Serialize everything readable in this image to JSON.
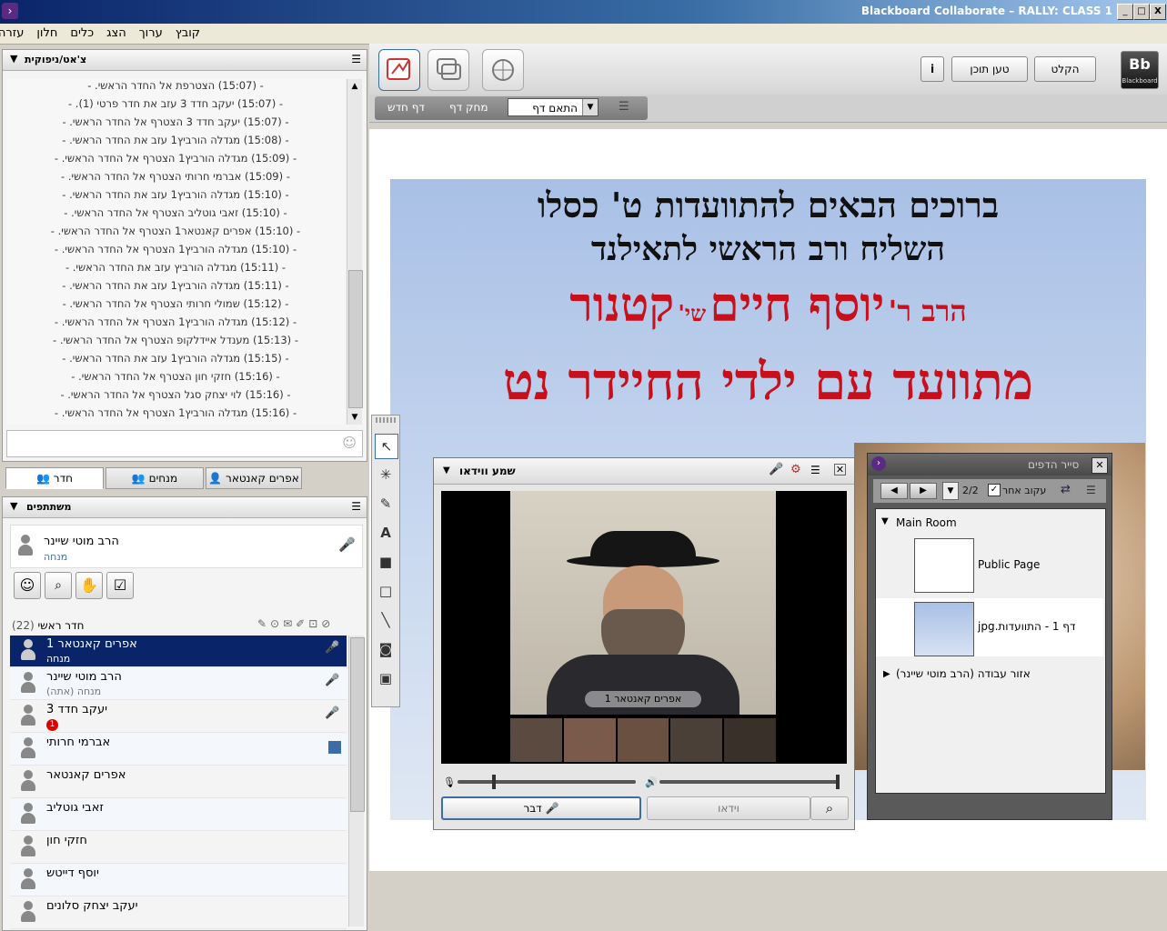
{
  "window": {
    "title": "Blackboard Collaborate – RALLY: CLASS 1",
    "minimize": "_",
    "maximize": "□",
    "close": "X"
  },
  "menu": [
    "עזרה",
    "חלון",
    "כלים",
    "הצג",
    "ערוך",
    "קובץ"
  ],
  "chat": {
    "title": "צ'אט/ניפוקית",
    "lines": [
      "- (15:07) הצטרפת אל החדר הראשי. -",
      "- (15:07) יעקב חדד 3 עזב את חדר פרטי (1). -",
      "- (15:07) יעקב חדד 3 הצטרף אל החדר הראשי. -",
      "- (15:08) מגדלה הורביץ1 עזב את החדר הראשי. -",
      "- (15:09) מגדלה הורביץ1 הצטרף אל החדר הראשי. -",
      "- (15:09) אברמי חרותי הצטרף אל החדר הראשי. -",
      "- (15:10) מגדלה הורביץ1 עזב את החדר הראשי. -",
      "- (15:10) זאבי גוטליב הצטרף אל החדר הראשי. -",
      "- (15:10) אפרים קאנטאר1 הצטרף אל החדר הראשי. -",
      "- (15:10) מגדלה הורביץ1 הצטרף אל החדר הראשי. -",
      "- (15:11) מגדלה הורביץ עזב את החדר הראשי. -",
      "- (15:11) מגדלה הורביץ1 עזב את החדר הראשי. -",
      "- (15:12) שמולי חרותי הצטרף אל החדר הראשי. -",
      "- (15:12) מגדלה הורביץ1 הצטרף אל החדר הראשי. -",
      "- (15:13) מענדל איידלקופ הצטרף אל החדר הראשי. -",
      "- (15:15) מגדלה הורביץ1 עזב את החדר הראשי. -",
      "- (15:16) חזקי חון הצטרף אל החדר הראשי. -",
      "- (15:16) לוי יצחק סגל הצטרף אל החדר הראשי. -",
      "- (15:16) מגדלה הורביץ1 הצטרף אל החדר הראשי. -"
    ]
  },
  "tabs": [
    "חדר",
    "מנחים",
    "אפרים קאנטאר"
  ],
  "participants": {
    "title": "משתתפים",
    "me": {
      "name": "הרב מוטי שיינר",
      "role": "מנחה"
    },
    "room_label": "חדר ראשי",
    "room_count": "(22)",
    "rows": [
      {
        "name": "אפרים קאנטאר 1",
        "role": "מנחה",
        "selected": true
      },
      {
        "name": "הרב מוטי שיינר",
        "role": "מנחה (אתה)"
      },
      {
        "name": "יעקב חדד 3",
        "role": "",
        "badge": "1"
      },
      {
        "name": "אברמי חרותי",
        "role": ""
      },
      {
        "name": "אפרים קאנטאר",
        "role": ""
      },
      {
        "name": "זאבי גוטליב",
        "role": ""
      },
      {
        "name": "חזקי חון",
        "role": ""
      },
      {
        "name": "יוסף דייטש",
        "role": ""
      },
      {
        "name": "יעקב יצחק סלונים",
        "role": ""
      }
    ]
  },
  "toolbar": {
    "info": "i",
    "load_content": "טען תוכן",
    "record": "הקלט",
    "logo": "Bb",
    "logo_sub": "Blackboard"
  },
  "page_toolbar": {
    "new_page": "דף חדש",
    "clear_page": "מחק דף",
    "fit_select": "התאם דף"
  },
  "slide": {
    "line1": "ברוכים הבאים להתוועדות ט' כסלו",
    "line2": "השליח ורב הראשי לתאילנד",
    "line3_prefix": "הרב ר'",
    "line3_name": "יוסף חיים",
    "line3_suffix": "שי'",
    "line3_last": "קטנור",
    "line4": "מתוועד עם ילדי החיידר נט"
  },
  "video": {
    "title": "שמע ווידאו",
    "caption": "אפרים קאנטאר 1",
    "talk": "דבר",
    "video_btn": "וידאו"
  },
  "explorer": {
    "title": "סייר הדפים",
    "page_count": "2/2",
    "follow_label": "עקוב אחר",
    "main_room": "Main Room",
    "public_page": "Public Page",
    "page1_label": "דף 1 - התוועדות.jpg",
    "workspace": "אזור עבודה (הרב מוטי שיינר)"
  },
  "colors": {
    "accent": "#0a246a",
    "slide_red": "#c8101c",
    "selected_row": "#0a246a"
  }
}
